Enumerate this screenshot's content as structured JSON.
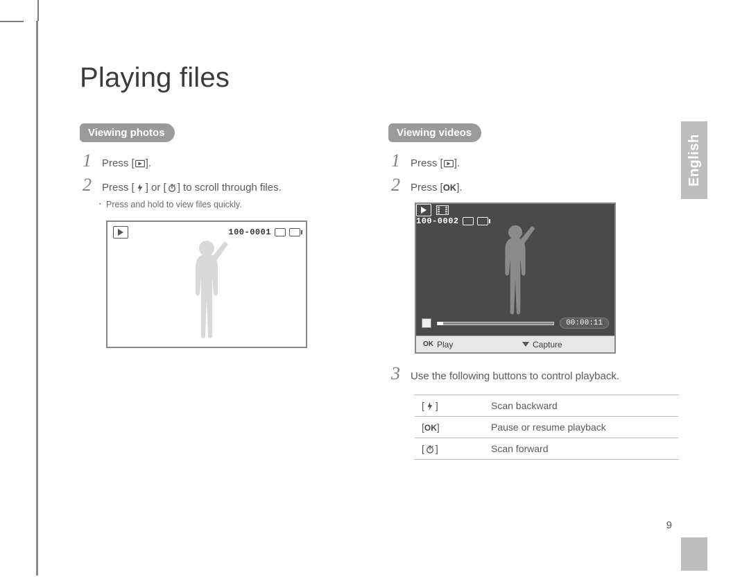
{
  "page": {
    "title": "Playing files",
    "language_tab": "English",
    "page_number": "9"
  },
  "photos": {
    "heading": "Viewing photos",
    "step1_a": "Press [",
    "step1_b": "].",
    "step2_a": "Press [",
    "step2_b": "] or [",
    "step2_c": "] to scroll through files.",
    "substep": "Press and hold to view files quickly.",
    "osd_counter": "100-0001"
  },
  "videos": {
    "heading": "Viewing videos",
    "step1_a": "Press [",
    "step1_b": "].",
    "step2_a": "Press [",
    "step2_b": "].",
    "step3": "Use the following buttons to control playback.",
    "osd_counter": "100-0002",
    "time": "00:00:11",
    "footer_play": "Play",
    "footer_capture": "Capture",
    "ok_label": "OK"
  },
  "controls": {
    "row1": "Scan backward",
    "row2": "Pause or resume playback",
    "row3": "Scan forward",
    "ok_label": "OK"
  }
}
